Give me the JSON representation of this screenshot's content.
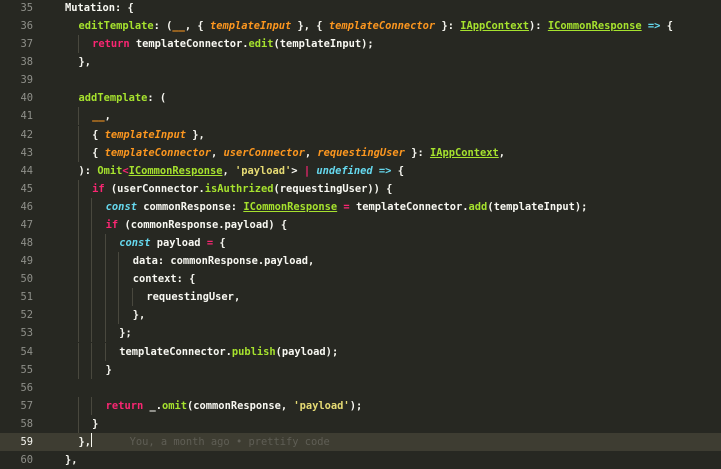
{
  "editor": {
    "current_line": 59,
    "blame": "You, a month ago • prettify code",
    "colors": {
      "background": "#272822",
      "current_line_background": "#3e3d32",
      "default": "#f8f8f2",
      "keyword": "#f92672",
      "function": "#a6e22e",
      "parameter": "#fd971f",
      "type": "#66d9ef",
      "string": "#e6db74",
      "interface": "#a6e22e"
    },
    "lines": [
      {
        "number": 35,
        "indent": 0,
        "tokens": [
          {
            "t": "Mutation",
            "c": "default"
          },
          {
            "t": ": {",
            "c": "default"
          }
        ]
      },
      {
        "number": 36,
        "indent": 1,
        "tokens": [
          {
            "t": "editTemplate",
            "c": "function"
          },
          {
            "t": ": (",
            "c": "default"
          },
          {
            "t": "__",
            "c": "parameter"
          },
          {
            "t": ", { ",
            "c": "default"
          },
          {
            "t": "templateInput",
            "c": "parameter"
          },
          {
            "t": " }, { ",
            "c": "default"
          },
          {
            "t": "templateConnector",
            "c": "parameter"
          },
          {
            "t": " }: ",
            "c": "default"
          },
          {
            "t": "IAppContext",
            "c": "interface"
          },
          {
            "t": "): ",
            "c": "default"
          },
          {
            "t": "ICommonResponse",
            "c": "interface"
          },
          {
            "t": " => ",
            "c": "type"
          },
          {
            "t": "{",
            "c": "default"
          }
        ]
      },
      {
        "number": 37,
        "indent": 2,
        "tokens": [
          {
            "t": "return",
            "c": "keyword"
          },
          {
            "t": " templateConnector.",
            "c": "default"
          },
          {
            "t": "edit",
            "c": "function"
          },
          {
            "t": "(templateInput);",
            "c": "default"
          }
        ]
      },
      {
        "number": 38,
        "indent": 1,
        "tokens": [
          {
            "t": "},",
            "c": "default"
          }
        ]
      },
      {
        "number": 39,
        "indent": 0,
        "tokens": []
      },
      {
        "number": 40,
        "indent": 1,
        "tokens": [
          {
            "t": "addTemplate",
            "c": "function"
          },
          {
            "t": ": (",
            "c": "default"
          }
        ]
      },
      {
        "number": 41,
        "indent": 2,
        "tokens": [
          {
            "t": "__",
            "c": "parameter"
          },
          {
            "t": ",",
            "c": "default"
          }
        ]
      },
      {
        "number": 42,
        "indent": 2,
        "tokens": [
          {
            "t": "{ ",
            "c": "default"
          },
          {
            "t": "templateInput",
            "c": "parameter"
          },
          {
            "t": " },",
            "c": "default"
          }
        ]
      },
      {
        "number": 43,
        "indent": 2,
        "tokens": [
          {
            "t": "{ ",
            "c": "default"
          },
          {
            "t": "templateConnector",
            "c": "parameter"
          },
          {
            "t": ", ",
            "c": "default"
          },
          {
            "t": "userConnector",
            "c": "parameter"
          },
          {
            "t": ", ",
            "c": "default"
          },
          {
            "t": "requestingUser",
            "c": "parameter"
          },
          {
            "t": " }: ",
            "c": "default"
          },
          {
            "t": "IAppContext",
            "c": "interface"
          },
          {
            "t": ",",
            "c": "default"
          }
        ]
      },
      {
        "number": 44,
        "indent": 1,
        "tokens": [
          {
            "t": "): ",
            "c": "default"
          },
          {
            "t": "Omit",
            "c": "function"
          },
          {
            "t": "<",
            "c": "keyword"
          },
          {
            "t": "ICommonResponse",
            "c": "interface"
          },
          {
            "t": ", ",
            "c": "default"
          },
          {
            "t": "'payload'",
            "c": "string"
          },
          {
            "t": "> ",
            "c": "default"
          },
          {
            "t": "|",
            "c": "keyword"
          },
          {
            "t": " ",
            "c": "default"
          },
          {
            "t": "undefined",
            "c": "type_italic"
          },
          {
            "t": " => ",
            "c": "type"
          },
          {
            "t": "{",
            "c": "default"
          }
        ]
      },
      {
        "number": 45,
        "indent": 2,
        "tokens": [
          {
            "t": "if",
            "c": "keyword"
          },
          {
            "t": " (userConnector.",
            "c": "default"
          },
          {
            "t": "isAuthrized",
            "c": "function"
          },
          {
            "t": "(requestingUser)) {",
            "c": "default"
          }
        ]
      },
      {
        "number": 46,
        "indent": 3,
        "tokens": [
          {
            "t": "const",
            "c": "type_italic"
          },
          {
            "t": " commonResponse: ",
            "c": "default"
          },
          {
            "t": "ICommonResponse",
            "c": "interface"
          },
          {
            "t": " = ",
            "c": "keyword"
          },
          {
            "t": "templateConnector.",
            "c": "default"
          },
          {
            "t": "add",
            "c": "function"
          },
          {
            "t": "(templateInput);",
            "c": "default"
          }
        ]
      },
      {
        "number": 47,
        "indent": 3,
        "tokens": [
          {
            "t": "if",
            "c": "keyword"
          },
          {
            "t": " (commonResponse.payload) {",
            "c": "default"
          }
        ]
      },
      {
        "number": 48,
        "indent": 4,
        "tokens": [
          {
            "t": "const",
            "c": "type_italic"
          },
          {
            "t": " payload ",
            "c": "default"
          },
          {
            "t": "=",
            "c": "keyword"
          },
          {
            "t": " {",
            "c": "default"
          }
        ]
      },
      {
        "number": 49,
        "indent": 5,
        "tokens": [
          {
            "t": "data: commonResponse.payload,",
            "c": "default"
          }
        ]
      },
      {
        "number": 50,
        "indent": 5,
        "tokens": [
          {
            "t": "context: {",
            "c": "default"
          }
        ]
      },
      {
        "number": 51,
        "indent": 6,
        "tokens": [
          {
            "t": "requestingUser,",
            "c": "default"
          }
        ]
      },
      {
        "number": 52,
        "indent": 5,
        "tokens": [
          {
            "t": "},",
            "c": "default"
          }
        ]
      },
      {
        "number": 53,
        "indent": 4,
        "tokens": [
          {
            "t": "};",
            "c": "default"
          }
        ]
      },
      {
        "number": 54,
        "indent": 4,
        "tokens": [
          {
            "t": "templateConnector.",
            "c": "default"
          },
          {
            "t": "publish",
            "c": "function"
          },
          {
            "t": "(payload);",
            "c": "default"
          }
        ]
      },
      {
        "number": 55,
        "indent": 3,
        "tokens": [
          {
            "t": "}",
            "c": "default"
          }
        ]
      },
      {
        "number": 56,
        "indent": 0,
        "tokens": []
      },
      {
        "number": 57,
        "indent": 3,
        "tokens": [
          {
            "t": "return",
            "c": "keyword"
          },
          {
            "t": " _.",
            "c": "default"
          },
          {
            "t": "omit",
            "c": "function"
          },
          {
            "t": "(commonResponse, ",
            "c": "default"
          },
          {
            "t": "'payload'",
            "c": "string"
          },
          {
            "t": ");",
            "c": "default"
          }
        ]
      },
      {
        "number": 58,
        "indent": 2,
        "tokens": [
          {
            "t": "}",
            "c": "default"
          }
        ]
      },
      {
        "number": 59,
        "indent": 1,
        "tokens": [
          {
            "t": "},",
            "c": "default"
          }
        ]
      },
      {
        "number": 60,
        "indent": 0,
        "tokens": [
          {
            "t": "},",
            "c": "default"
          }
        ]
      }
    ]
  }
}
